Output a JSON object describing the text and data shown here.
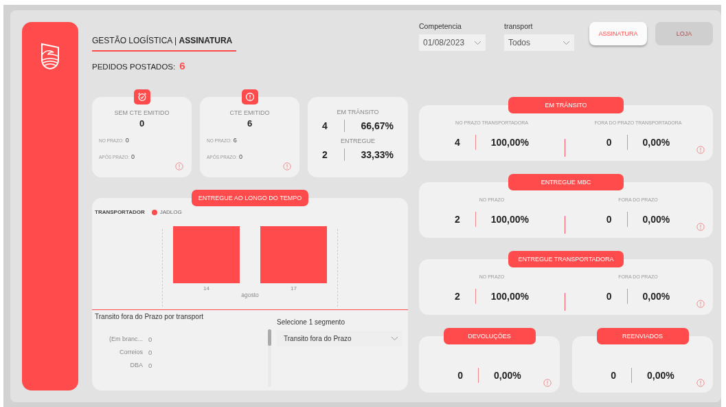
{
  "header": {
    "title": "GESTÃO LOGÍSTICA | **ASSINATURA**",
    "pedidos_label": "PEDIDOS POSTADOS:",
    "pedidos_value": "6"
  },
  "filters": [
    {
      "label": "Competencia",
      "value": "01/08/2023"
    },
    {
      "label": "transport",
      "value": "Todos"
    }
  ],
  "view_buttons": [
    {
      "label": "ASSINATURA",
      "selected": true
    },
    {
      "label": "LOJA",
      "selected": false
    }
  ],
  "kpi_cards": [
    {
      "kind": "detail",
      "title": "SEM CTE EMITIDO",
      "value": "0",
      "rows": [
        {
          "label": "NO PRAZO:",
          "value": "0"
        },
        {
          "label": "APÓS PRAZO:",
          "value": "0"
        }
      ]
    },
    {
      "kind": "detail",
      "title": "CTE EMITIDO",
      "value": "6",
      "rows": [
        {
          "label": "NO PRAZO:",
          "value": "6"
        },
        {
          "label": "APÓS PRAZO:",
          "value": "0"
        }
      ]
    },
    {
      "kind": "split",
      "groups": [
        {
          "title": "EM TRÂNSITO",
          "count": "4",
          "percent": "66,67%"
        },
        {
          "title": "ENTREGUE",
          "count": "2",
          "percent": "33,33%"
        }
      ]
    }
  ],
  "chart_panel": {
    "title": "ENTREGUE AO LONGO DO TEMPO",
    "legend_title": "TRANSPORTADOR",
    "series": {
      "name": "JADLOG",
      "color": "#ff4b4b"
    },
    "categories": [
      "14",
      "17"
    ],
    "axis_label": "agosto"
  },
  "late_list": {
    "title": "Transito fora do Prazo por transport",
    "rows": [
      {
        "label": "(Em branc...",
        "value": "0"
      },
      {
        "label": "Correios",
        "value": "0"
      },
      {
        "label": "DBA",
        "value": "0"
      }
    ]
  },
  "segment": {
    "label": "Selecione 1 segmento",
    "value": "Transito fora do Prazo"
  },
  "sections": [
    {
      "title": "EM TRÂNSITO",
      "columns": [
        {
          "label": "NO PRAZO TRANSPORTADORA",
          "count": "4",
          "percent": "100,00%"
        },
        {
          "label": "FORA DO PRAZO TRANSPORTADORA",
          "count": "0",
          "percent": "0,00%"
        }
      ]
    },
    {
      "title": "ENTREGUE MBC",
      "columns": [
        {
          "label": "NO PRAZO",
          "count": "2",
          "percent": "100,00%"
        },
        {
          "label": "FORA DO PRAZO",
          "count": "0",
          "percent": "0,00%"
        }
      ]
    },
    {
      "title": "ENTREGUE TRANSPORTADORA",
      "columns": [
        {
          "label": "NO PRAZO",
          "count": "2",
          "percent": "100,00%"
        },
        {
          "label": "FORA DO PRAZO",
          "count": "0",
          "percent": "0,00%"
        }
      ]
    }
  ],
  "small_sections": [
    {
      "title": "DEVOLUÇÕES",
      "count": "0",
      "percent": "0,00%"
    },
    {
      "title": "REENVIADOS",
      "count": "0",
      "percent": "0,00%"
    }
  ]
}
